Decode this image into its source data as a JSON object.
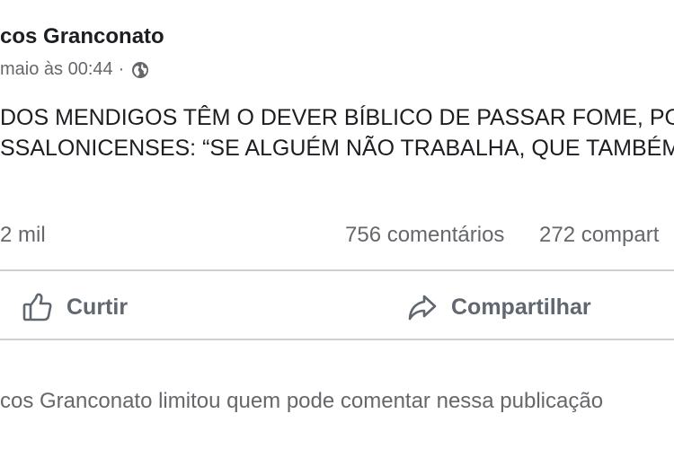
{
  "post": {
    "author": "cos Granconato",
    "date": "maio às 00:44",
    "separator": "·",
    "visibility_icon": "globe-icon",
    "text_lines": [
      "DOS MENDIGOS TÊM O DEVER BÍBLICO DE PASSAR FOME, PO",
      "SSALONICENSES: “SE ALGUÉM NÃO TRABALHA, QUE TAMBÉM"
    ]
  },
  "stats": {
    "reactions": "2 mil",
    "comments": "756 comentários",
    "shares": "272 compart"
  },
  "actions": {
    "like_label": "Curtir",
    "like_icon": "thumbs-up-icon",
    "share_label": "Compartilhar",
    "share_icon": "share-arrow-icon"
  },
  "restriction_notice": "cos Granconato limitou quem pode comentar nessa publicação",
  "colors": {
    "primary_text": "#1c1e21",
    "secondary_text": "#65676b",
    "action_text": "#606770",
    "divider": "#ced0d4",
    "background": "#ffffff"
  }
}
